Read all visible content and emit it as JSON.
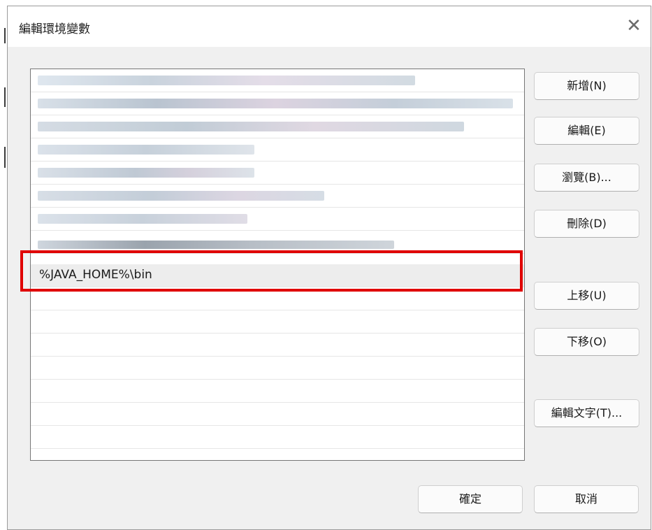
{
  "dialog": {
    "title": "編輯環境變數",
    "close_icon": "close-icon"
  },
  "list": {
    "obscured_rows": 8,
    "selected_entry": "%JAVA_HOME%\\bin"
  },
  "buttons": {
    "new": "新增(N)",
    "edit": "編輯(E)",
    "browse": "瀏覽(B)...",
    "delete": "刪除(D)",
    "move_up": "上移(U)",
    "move_down": "下移(O)",
    "edit_text": "編輯文字(T)...",
    "ok": "確定",
    "cancel": "取消"
  },
  "colors": {
    "highlight": "#e00000",
    "dialog_bg": "#f0f0f0"
  }
}
